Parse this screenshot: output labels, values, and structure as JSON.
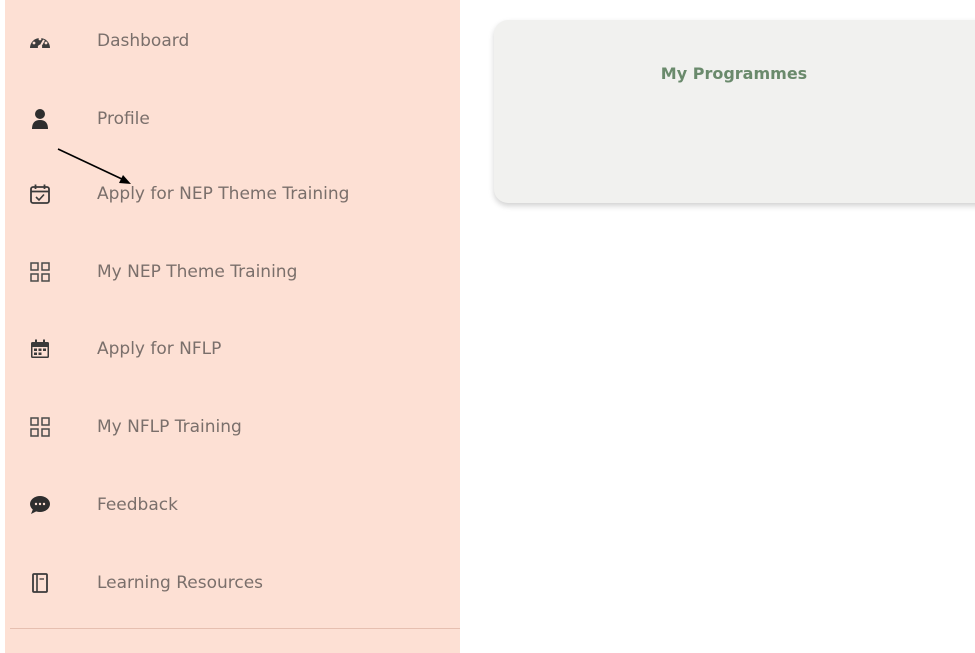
{
  "sidebar": {
    "items": [
      {
        "label": "Dashboard",
        "icon": "dashboard-gauge-icon"
      },
      {
        "label": "Profile",
        "icon": "user-icon"
      },
      {
        "label": "Apply for NEP Theme Training",
        "icon": "calendar-check-icon"
      },
      {
        "label": "My NEP Theme Training",
        "icon": "grid-icon"
      },
      {
        "label": "Apply for NFLP",
        "icon": "calendar-icon"
      },
      {
        "label": "My NFLP Training",
        "icon": "grid-icon"
      },
      {
        "label": "Feedback",
        "icon": "comment-icon"
      },
      {
        "label": "Learning Resources",
        "icon": "book-icon"
      }
    ]
  },
  "main": {
    "card_title": "My Programmes"
  },
  "colors": {
    "sidebar_bg": "#fde0d4",
    "card_title": "#6a8a6c",
    "label_text": "#7a6f6b"
  }
}
